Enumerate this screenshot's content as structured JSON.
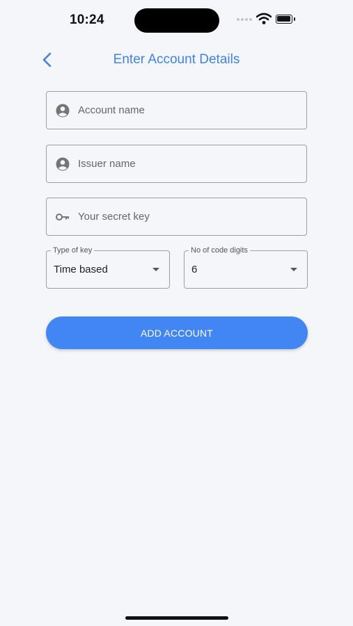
{
  "status_bar": {
    "time": "10:24",
    "icons": [
      "cellular-signal-icon",
      "wifi-icon",
      "battery-icon"
    ]
  },
  "nav": {
    "back_icon": "chevron-left-icon",
    "title": "Enter Account Details"
  },
  "form": {
    "account_name": {
      "placeholder": "Account name",
      "value": "",
      "icon": "account-circle-icon"
    },
    "issuer_name": {
      "placeholder": "Issuer name",
      "value": "",
      "icon": "account-circle-icon"
    },
    "secret_key": {
      "placeholder": "Your secret key",
      "value": "",
      "icon": "key-icon"
    },
    "key_type": {
      "label": "Type of key",
      "value": "Time based"
    },
    "code_digits": {
      "label": "No of code digits",
      "value": "6"
    },
    "submit_label": "ADD ACCOUNT"
  },
  "colors": {
    "accent": "#3e82e6",
    "button": "#4286f4",
    "background": "#f5f6f9",
    "border": "#9e9e9e"
  }
}
